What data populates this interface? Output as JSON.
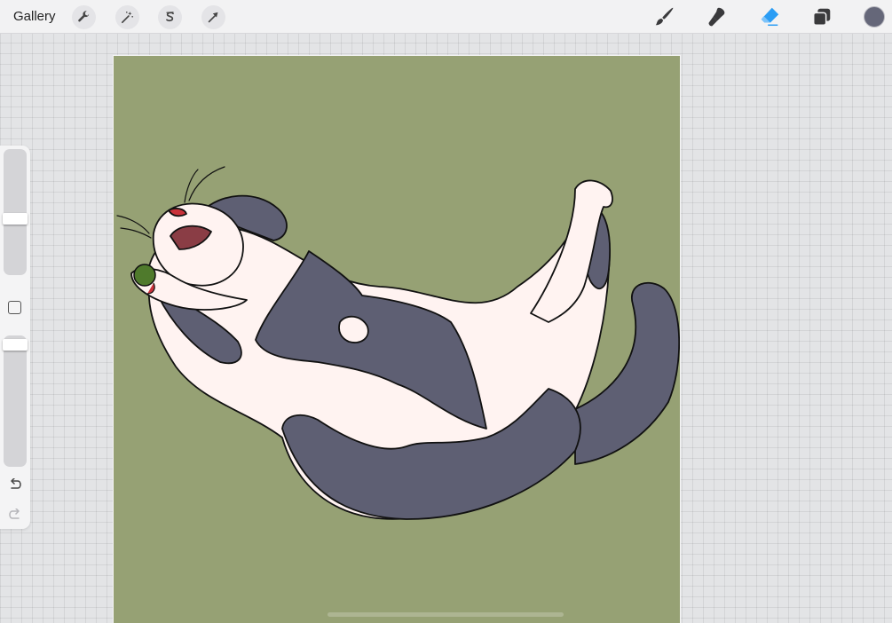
{
  "app": {
    "gallery_label": "Gallery"
  },
  "toolbar_left": {
    "icons": [
      "wrench-icon",
      "magic-wand-icon",
      "selection-s-icon",
      "transform-arrow-icon"
    ]
  },
  "toolbar_right": {
    "icons": [
      "brush-icon",
      "smudge-icon",
      "eraser-icon",
      "layers-icon"
    ],
    "active_tool": "eraser",
    "current_color": "#656779"
  },
  "sidebar": {
    "brush_size_level": 0.44,
    "opacity_level": 0.97,
    "icons": [
      "modify-square-icon",
      "undo-icon",
      "redo-icon"
    ]
  },
  "colors": {
    "accent": "#2b9df4",
    "canvas_background": "#96a174",
    "fur_dark": "#5e5f73",
    "fur_light": "#fff3f1",
    "mouth": "#8a3d45",
    "toy_green": "#4f7a2c",
    "toy_red": "#c9323a"
  }
}
